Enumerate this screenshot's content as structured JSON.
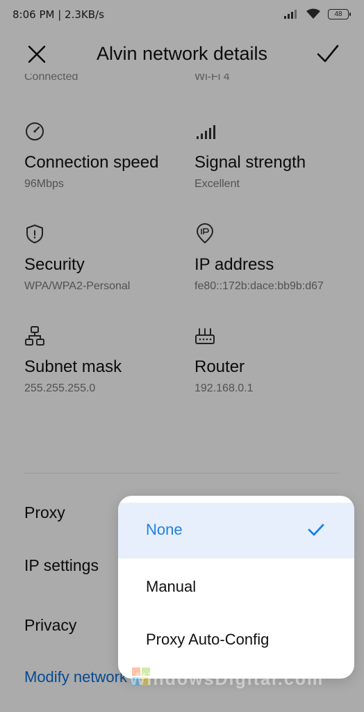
{
  "status_bar": {
    "time_speed": "8:06 PM | 2.3KB/s",
    "battery": "48"
  },
  "header": {
    "title": "Alvin network details",
    "close_icon": "close-icon",
    "confirm_icon": "checkmark-icon"
  },
  "clipped_row": {
    "left": "Connected",
    "right": "Wi-Fi 4"
  },
  "details": [
    {
      "icon": "speedometer-icon",
      "title": "Connection speed",
      "value": "96Mbps"
    },
    {
      "icon": "signal-bars-icon",
      "title": "Signal strength",
      "value": "Excellent"
    },
    {
      "icon": "shield-icon",
      "title": "Security",
      "value": "WPA/WPA2-Personal"
    },
    {
      "icon": "ip-pin-icon",
      "title": "IP address",
      "value": "fe80::172b:dace:bb9b:d67"
    },
    {
      "icon": "network-tree-icon",
      "title": "Subnet mask",
      "value": "255.255.255.0"
    },
    {
      "icon": "router-icon",
      "title": "Router",
      "value": "192.168.0.1"
    }
  ],
  "settings_rows": {
    "proxy": "Proxy",
    "ip_settings": "IP settings",
    "privacy": "Privacy",
    "modify_network": "Modify network"
  },
  "proxy_popup": {
    "options": [
      "None",
      "Manual",
      "Proxy Auto-Config"
    ],
    "selected": "None",
    "selected_icon": "checkmark-icon"
  },
  "watermark": "WindowsDigital.com",
  "colors": {
    "accent": "#1d80e6",
    "link": "#0a6fd7",
    "selected_bg": "#e6effb"
  }
}
